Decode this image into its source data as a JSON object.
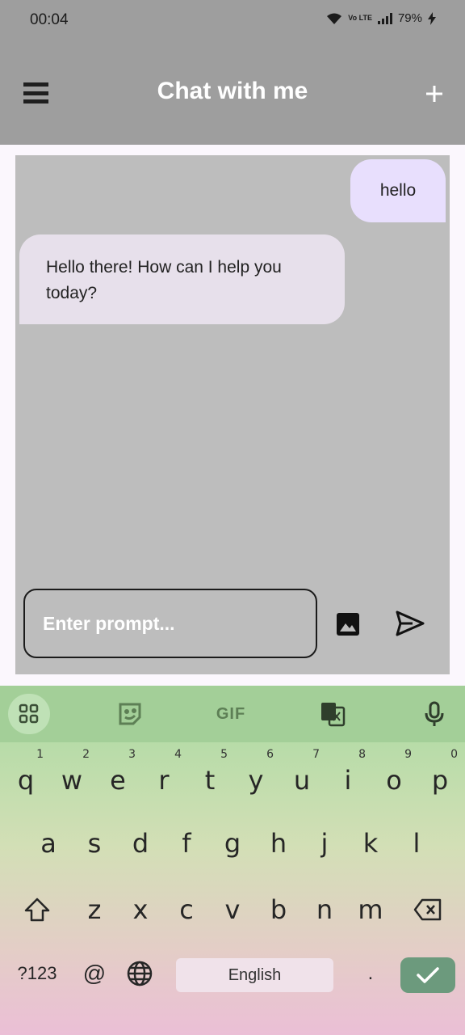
{
  "status": {
    "time": "00:04",
    "network": "Vo LTE",
    "battery": "79%"
  },
  "appbar": {
    "title": "Chat with me"
  },
  "chat": {
    "messages": [
      {
        "role": "user",
        "text": "hello"
      },
      {
        "role": "bot",
        "text": "Hello there! How can I help you today?"
      }
    ],
    "input": {
      "placeholder": "Enter prompt..."
    }
  },
  "keyboard": {
    "toolbar": {
      "gif_label": "GIF"
    },
    "row1": [
      {
        "k": "q",
        "n": "1"
      },
      {
        "k": "w",
        "n": "2"
      },
      {
        "k": "e",
        "n": "3"
      },
      {
        "k": "r",
        "n": "4"
      },
      {
        "k": "t",
        "n": "5"
      },
      {
        "k": "y",
        "n": "6"
      },
      {
        "k": "u",
        "n": "7"
      },
      {
        "k": "i",
        "n": "8"
      },
      {
        "k": "o",
        "n": "9"
      },
      {
        "k": "p",
        "n": "0"
      }
    ],
    "row2": [
      "a",
      "s",
      "d",
      "f",
      "g",
      "h",
      "j",
      "k",
      "l"
    ],
    "row3": [
      "z",
      "x",
      "c",
      "v",
      "b",
      "n",
      "m"
    ],
    "symbols_label": "?123",
    "at_label": "@",
    "space_label": "English",
    "period_label": "."
  },
  "colors": {
    "app_bar": "#9e9e9e",
    "chat_bg": "#bdbdbd",
    "user_bubble": "#e8dffd",
    "bot_bubble": "#e7e0eb",
    "enter_key": "#6c9a7d"
  }
}
